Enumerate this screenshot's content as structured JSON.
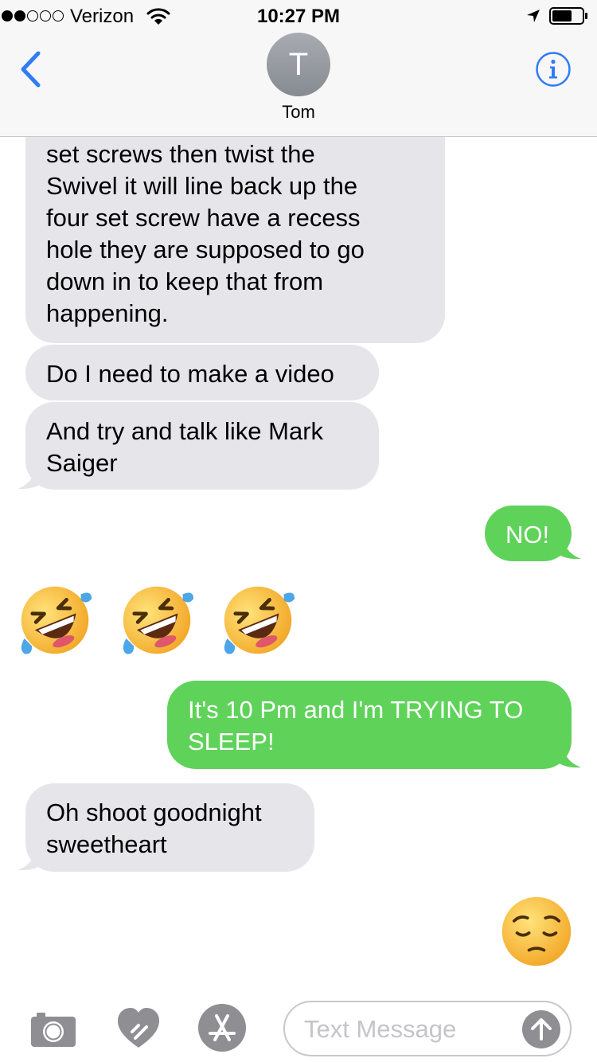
{
  "status_bar": {
    "carrier": "Verizon",
    "time": "10:27 PM",
    "signal_bars_filled": 2,
    "signal_bars_total": 5
  },
  "header": {
    "avatar_initial": "T",
    "contact_name": "Tom"
  },
  "messages": [
    {
      "direction": "incoming",
      "text": "set screws then twist the\nSwivel it will line back up the\nfour set screw have a recess\nhole they are supposed to go\ndown in to keep that from\nhappening."
    },
    {
      "direction": "incoming",
      "text": "Do I need to make a video"
    },
    {
      "direction": "incoming",
      "text": "And try and talk like Mark\nSaiger"
    },
    {
      "direction": "outgoing",
      "text": "NO!"
    },
    {
      "direction": "incoming",
      "emoji": "rolling-on-the-floor-laughing x3"
    },
    {
      "direction": "outgoing",
      "text": "It's 10 Pm and I'm TRYING TO\nSLEEP!"
    },
    {
      "direction": "incoming",
      "text": "Oh shoot goodnight\nsweetheart"
    },
    {
      "direction": "outgoing",
      "emoji": "pensive-face"
    }
  ],
  "input": {
    "placeholder": "Text Message",
    "value": ""
  },
  "colors": {
    "ios_blue": "#2f7cf6",
    "incoming_bubble": "#e5e5ea",
    "outgoing_bubble": "#5fd25a",
    "icon_gray": "#8e8e93"
  },
  "icons": [
    "back-chevron-icon",
    "info-icon",
    "camera-icon",
    "digital-touch-heart-icon",
    "app-store-icon",
    "send-arrow-icon",
    "wifi-icon",
    "location-arrow-icon",
    "battery-icon"
  ]
}
